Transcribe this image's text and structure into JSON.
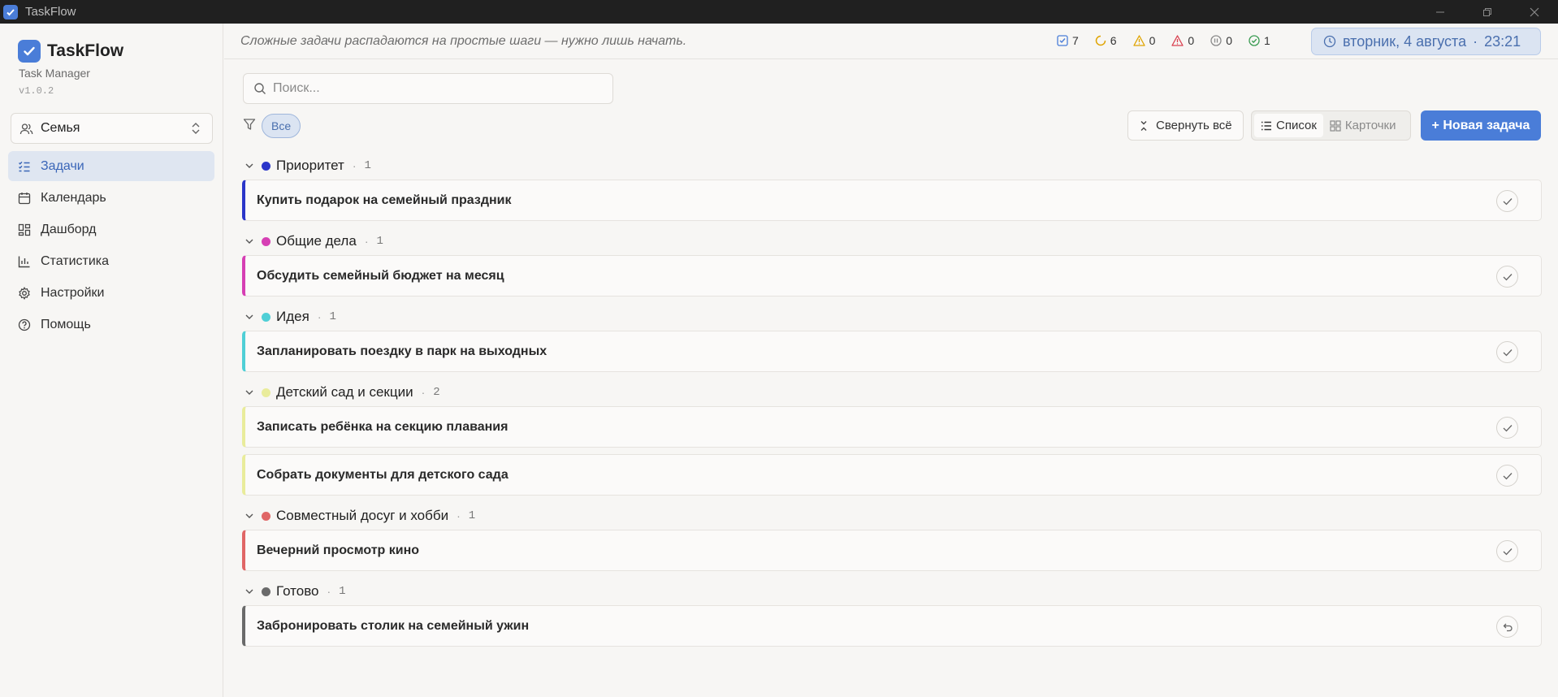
{
  "window": {
    "title": "TaskFlow"
  },
  "brand": {
    "name": "TaskFlow",
    "subtitle": "Task Manager",
    "version": "v1.0.2"
  },
  "workspace": {
    "label": "Семья"
  },
  "nav": {
    "items": [
      {
        "label": "Задачи",
        "icon": "list-check-icon",
        "active": true
      },
      {
        "label": "Календарь",
        "icon": "calendar-icon"
      },
      {
        "label": "Дашборд",
        "icon": "dashboard-icon"
      },
      {
        "label": "Статистика",
        "icon": "bar-chart-icon"
      },
      {
        "label": "Настройки",
        "icon": "gear-icon"
      },
      {
        "label": "Помощь",
        "icon": "help-icon"
      }
    ]
  },
  "topbar": {
    "quote": "Сложные задачи распадаются на простые шаги — нужно лишь начать.",
    "stats": [
      {
        "icon": "checkbox-icon",
        "value": "7",
        "color": "#4a7dd8"
      },
      {
        "icon": "progress-icon",
        "value": "6",
        "color": "#e0a400"
      },
      {
        "icon": "warning-icon",
        "value": "0",
        "color": "#e0a400"
      },
      {
        "icon": "alert-icon",
        "value": "0",
        "color": "#d9404f"
      },
      {
        "icon": "pause-icon",
        "value": "0",
        "color": "#8a8a8a"
      },
      {
        "icon": "done-icon",
        "value": "1",
        "color": "#3a9b52"
      }
    ],
    "date": "вторник, 4 августа",
    "time": "23:21"
  },
  "toolbar": {
    "search_placeholder": "Поиск...",
    "filter_chip": "Все",
    "collapse_label": "Свернуть всё",
    "view_list": "Список",
    "view_cards": "Карточки",
    "new_task": "+ Новая задача"
  },
  "groups": [
    {
      "name": "Приоритет",
      "count": "1",
      "color": "#2b36c9",
      "tasks": [
        {
          "title": "Купить подарок на семейный праздник"
        }
      ]
    },
    {
      "name": "Общие дела",
      "count": "1",
      "color": "#d63fb4",
      "tasks": [
        {
          "title": "Обсудить семейный бюджет на месяц"
        }
      ]
    },
    {
      "name": "Идея",
      "count": "1",
      "color": "#4fcfd6",
      "tasks": [
        {
          "title": "Запланировать поездку в парк на выходных"
        }
      ]
    },
    {
      "name": "Детский сад и секции",
      "count": "2",
      "color": "#e9ec9b",
      "tasks": [
        {
          "title": "Записать ребёнка на секцию плавания"
        },
        {
          "title": "Собрать документы для детского сада"
        }
      ]
    },
    {
      "name": "Совместный досуг и хобби",
      "count": "1",
      "color": "#e06666",
      "tasks": [
        {
          "title": "Вечерний просмотр кино"
        }
      ]
    },
    {
      "name": "Готово",
      "count": "1",
      "color": "#6a6a6a",
      "tasks": [
        {
          "title": "Забронировать столик на семейный ужин",
          "done": true
        }
      ]
    }
  ]
}
